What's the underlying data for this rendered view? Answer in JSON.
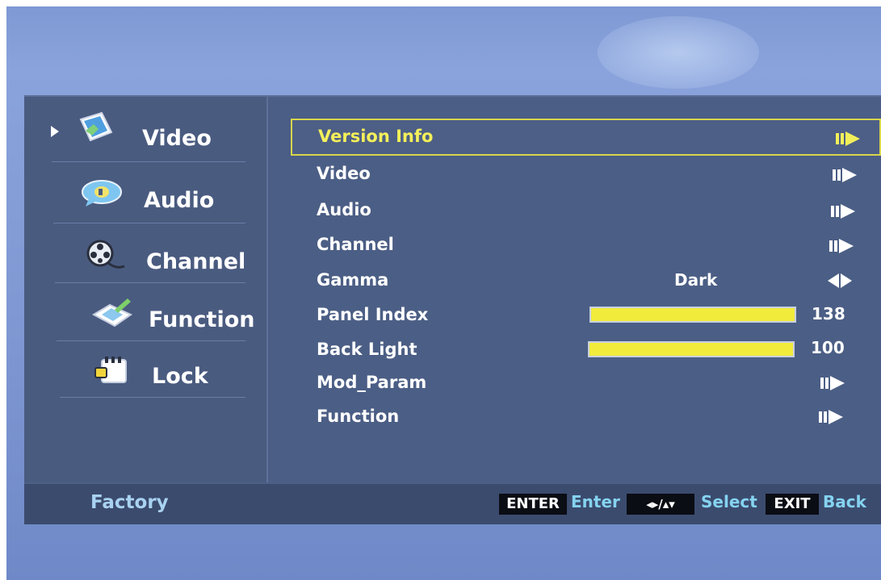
{
  "left_nav": {
    "items": [
      {
        "label": "Video",
        "icon": "video-icon",
        "active": true
      },
      {
        "label": "Audio",
        "icon": "audio-icon",
        "active": false
      },
      {
        "label": "Channel",
        "icon": "channel-icon",
        "active": false
      },
      {
        "label": "Function",
        "icon": "function-icon",
        "active": false
      },
      {
        "label": "Lock",
        "icon": "lock-icon",
        "active": false
      }
    ]
  },
  "menu": {
    "rows": [
      {
        "label": "Version Info",
        "control": "submenu-arrow",
        "selected": true
      },
      {
        "label": "Video",
        "control": "submenu-arrow"
      },
      {
        "label": "Audio",
        "control": "submenu-arrow"
      },
      {
        "label": "Channel",
        "control": "submenu-arrow"
      },
      {
        "label": "Gamma",
        "control": "option-toggle",
        "value": "Dark"
      },
      {
        "label": "Panel Index",
        "control": "slider",
        "value": "138",
        "level_fraction": 1.0
      },
      {
        "label": "Back Light",
        "control": "slider",
        "value": "100",
        "level_fraction": 1.0
      },
      {
        "label": "Mod_Param",
        "control": "submenu-arrow"
      },
      {
        "label": "Function",
        "control": "submenu-arrow"
      }
    ]
  },
  "footer": {
    "title": "Factory",
    "keys": [
      {
        "key": "ENTER",
        "label": "Enter"
      },
      {
        "key": "◂▸/▴▾",
        "label": "Select"
      },
      {
        "key": "EXIT",
        "label": "Back"
      }
    ]
  },
  "colors": {
    "osd_background": "#4c5f86",
    "selection_border": "#d9d64a",
    "selected_text": "#f3ef5a",
    "slider_fill": "#f1ec3c",
    "footer_title": "#a9d2f1",
    "key_label": "#85d3f0"
  }
}
